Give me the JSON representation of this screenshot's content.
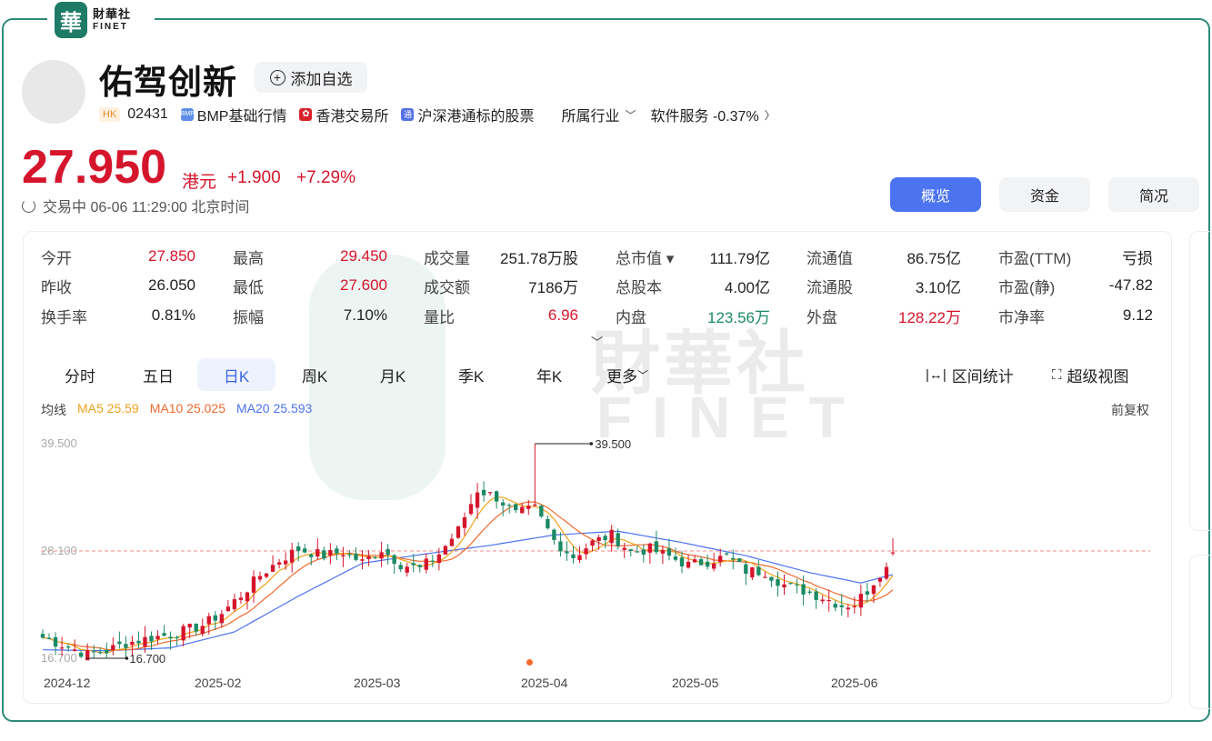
{
  "brand": {
    "seal": "華",
    "name_cn": "財華社",
    "name_en": "FINET"
  },
  "stock": {
    "name": "佑驾创新",
    "watch_label": "添加自选",
    "market_tag": "HK",
    "code": "02431",
    "tags": [
      {
        "icon": "bmp-icon",
        "icon_text": "BMP",
        "label": "BMP基础行情"
      },
      {
        "icon": "hkex-icon",
        "icon_text": "✿",
        "label": "香港交易所"
      },
      {
        "icon": "stock-connect-icon",
        "icon_text": "通",
        "label": "沪深港通标的股票"
      }
    ],
    "industry_label": "所属行业",
    "industry_value": "软件服务 -0.37%"
  },
  "quote": {
    "price": "27.950",
    "currency": "港元",
    "change": "+1.900",
    "change_pct": "+7.29%",
    "status": "交易中 06-06 11:29:00 北京时间"
  },
  "view_tabs": [
    "概览",
    "资金",
    "简况"
  ],
  "stats": [
    [
      {
        "label": "今开",
        "value": "27.850",
        "color": "red"
      },
      {
        "label": "昨收",
        "value": "26.050",
        "color": "normal"
      },
      {
        "label": "换手率",
        "value": "0.81%",
        "color": "normal"
      }
    ],
    [
      {
        "label": "最高",
        "value": "29.450",
        "color": "red"
      },
      {
        "label": "最低",
        "value": "27.600",
        "color": "red"
      },
      {
        "label": "振幅",
        "value": "7.10%",
        "color": "normal"
      }
    ],
    [
      {
        "label": "成交量",
        "value": "251.78万股",
        "color": "normal"
      },
      {
        "label": "成交额",
        "value": "7186万",
        "color": "normal"
      },
      {
        "label": "量比",
        "value": "6.96",
        "color": "red"
      }
    ],
    [
      {
        "label": "总市值 ▾",
        "value": "111.79亿",
        "color": "normal"
      },
      {
        "label": "总股本",
        "value": "4.00亿",
        "color": "normal"
      },
      {
        "label": "内盘",
        "value": "123.56万",
        "color": "green"
      }
    ],
    [
      {
        "label": "流通值",
        "value": "86.75亿",
        "color": "normal"
      },
      {
        "label": "流通股",
        "value": "3.10亿",
        "color": "normal"
      },
      {
        "label": "外盘",
        "value": "128.22万",
        "color": "red"
      }
    ],
    [
      {
        "label": "市盈(TTM)",
        "value": "亏损",
        "color": "normal"
      },
      {
        "label": "市盈(静)",
        "value": "-47.82",
        "color": "normal"
      },
      {
        "label": "市净率",
        "value": "9.12",
        "color": "normal"
      }
    ]
  ],
  "period_tabs": [
    "分时",
    "五日",
    "日K",
    "周K",
    "月K",
    "季K",
    "年K",
    "更多"
  ],
  "active_period": "日K",
  "tools": {
    "range_stats": "区间统计",
    "super_view": "超级视图"
  },
  "ma_legend": {
    "title": "均线",
    "ma5": "MA5 25.59",
    "ma10": "MA10 25.025",
    "ma20": "MA20 25.593"
  },
  "adjust_label": "前复权",
  "colors": {
    "up": "#d5152c",
    "down": "#1a8a64",
    "accent": "#4c73f0",
    "ma5": "#f0a21c",
    "ma10": "#f06a2e",
    "ma20": "#4c73f0",
    "frame": "#2e8a7a"
  },
  "chart_data": {
    "type": "candlestick",
    "y_ticks": [
      "39.500",
      "28.100",
      "16.700"
    ],
    "ylim": [
      16.7,
      39.5
    ],
    "x_ticks": [
      "2024-12",
      "2025-02",
      "2025-03",
      "2025-04",
      "2025-05",
      "2025-06"
    ],
    "max_label": "39.500",
    "min_label": "16.700",
    "last_close": 28.1,
    "anchors": [
      [
        0,
        18.9
      ],
      [
        4,
        17.9
      ],
      [
        7,
        17.1
      ],
      [
        10,
        17.5
      ],
      [
        13,
        18.3
      ],
      [
        17,
        18.9
      ],
      [
        20,
        19.2
      ],
      [
        25,
        20.2
      ],
      [
        28,
        21.5
      ],
      [
        31,
        23.4
      ],
      [
        34,
        25.5
      ],
      [
        37,
        27.1
      ],
      [
        40,
        28.3
      ],
      [
        44,
        27.6
      ],
      [
        47,
        28.0
      ],
      [
        50,
        26.9
      ],
      [
        53,
        28.3
      ],
      [
        56,
        26.7
      ],
      [
        59,
        26.2
      ],
      [
        62,
        27.8
      ],
      [
        65,
        30.3
      ],
      [
        68,
        34.6
      ],
      [
        71,
        33.8
      ],
      [
        74,
        32.0
      ],
      [
        77,
        32.6
      ],
      [
        80,
        29.2
      ],
      [
        83,
        27.5
      ],
      [
        86,
        29.0
      ],
      [
        89,
        29.8
      ],
      [
        92,
        28.0
      ],
      [
        95,
        28.3
      ],
      [
        98,
        27.5
      ],
      [
        101,
        26.6
      ],
      [
        104,
        27.0
      ],
      [
        107,
        27.5
      ],
      [
        110,
        26.0
      ],
      [
        113,
        25.9
      ],
      [
        116,
        24.5
      ],
      [
        119,
        23.9
      ],
      [
        122,
        23.2
      ],
      [
        125,
        22.3
      ],
      [
        127,
        22.5
      ],
      [
        129,
        23.9
      ],
      [
        131,
        25.8
      ],
      [
        133,
        26.7
      ]
    ],
    "ma20_anchors": [
      [
        0,
        17.6
      ],
      [
        10,
        17.5
      ],
      [
        20,
        17.8
      ],
      [
        30,
        19.5
      ],
      [
        40,
        23.3
      ],
      [
        50,
        26.8
      ],
      [
        60,
        27.8
      ],
      [
        70,
        28.7
      ],
      [
        80,
        29.8
      ],
      [
        90,
        30.2
      ],
      [
        100,
        29.0
      ],
      [
        110,
        27.6
      ],
      [
        120,
        25.8
      ],
      [
        128,
        24.7
      ],
      [
        133,
        25.6
      ]
    ],
    "candle_count": 134
  }
}
